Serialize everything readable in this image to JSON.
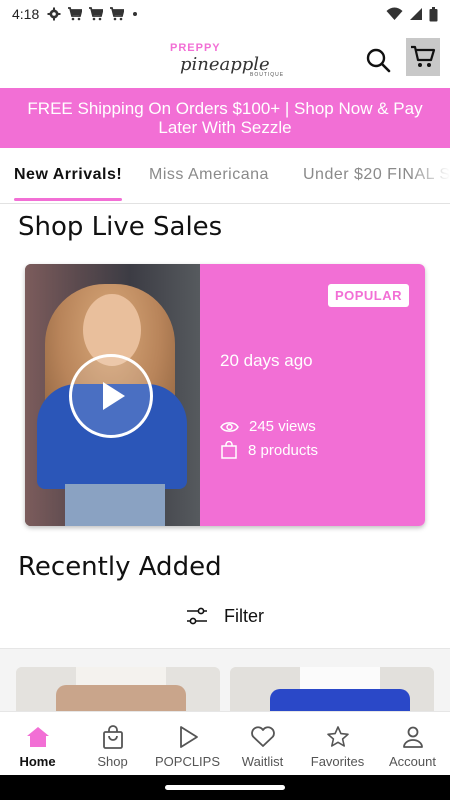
{
  "status_bar": {
    "time": "4:18",
    "notification_icons": [
      "gear-icon",
      "cart-icon",
      "cart-icon",
      "cart-icon",
      "dot-icon"
    ],
    "system_icons": [
      "wifi-icon",
      "signal-icon",
      "battery-icon"
    ]
  },
  "header": {
    "logo": {
      "line1": "PREPPY",
      "line2": "pineapple",
      "line3": "BOUTIQUE"
    },
    "icons": [
      "search-icon",
      "cart-icon"
    ]
  },
  "promo": {
    "text": "FREE Shipping On Orders $100+ | Shop Now & Pay Later With Sezzle"
  },
  "tabs": [
    {
      "label": "New Arrivals!",
      "active": true
    },
    {
      "label": "Miss Americana",
      "active": false
    },
    {
      "label": "Under $20 FINAL S",
      "active": false
    }
  ],
  "live_sales": {
    "title": "Shop Live Sales",
    "card": {
      "badge": "POPULAR",
      "ago": "20 days ago",
      "views": "245 views",
      "products": "8 products"
    }
  },
  "recently_added": {
    "title": "Recently Added",
    "filter_label": "Filter"
  },
  "bottom_nav": [
    {
      "label": "Home",
      "icon": "home-icon",
      "active": true
    },
    {
      "label": "Shop",
      "icon": "shopping-bag-icon",
      "active": false
    },
    {
      "label": "POPCLIPS",
      "icon": "play-icon",
      "active": false
    },
    {
      "label": "Waitlist",
      "icon": "heart-icon",
      "active": false
    },
    {
      "label": "Favorites",
      "icon": "star-icon",
      "active": false
    },
    {
      "label": "Account",
      "icon": "person-icon",
      "active": false
    }
  ],
  "colors": {
    "brand_pink": "#f26fd5",
    "text_dark": "#111111",
    "text_muted": "#8a8a8a"
  }
}
